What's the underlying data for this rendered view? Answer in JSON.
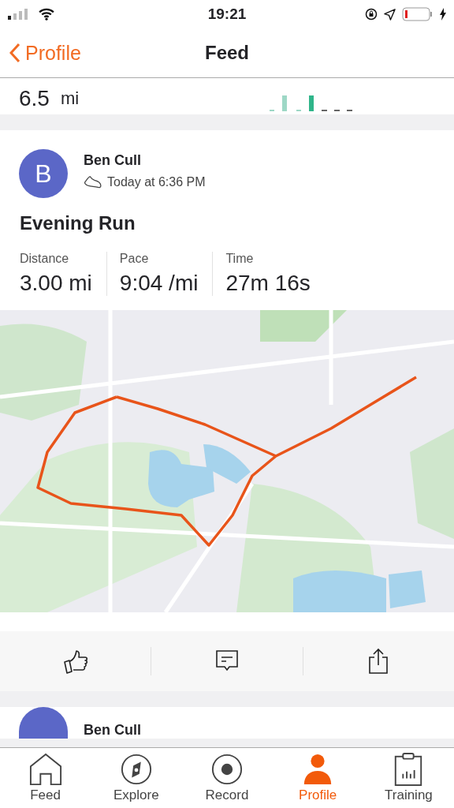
{
  "status_bar": {
    "time": "19:21"
  },
  "nav": {
    "back": "Profile",
    "title": "Feed"
  },
  "prev_card": {
    "value": "6.5",
    "unit": "mi"
  },
  "post": {
    "avatar": "B",
    "athlete": "Ben Cull",
    "time": "Today at 6:36 PM",
    "title": "Evening Run",
    "stats": [
      {
        "label": "Distance",
        "value": "3.00 mi"
      },
      {
        "label": "Pace",
        "value": "9:04 /mi"
      },
      {
        "label": "Time",
        "value": "27m 16s"
      }
    ]
  },
  "next_post": {
    "athlete": "Ben Cull"
  },
  "tabs": [
    {
      "label": "Feed",
      "kind": "home",
      "selected": false
    },
    {
      "label": "Explore",
      "kind": "explore",
      "selected": false
    },
    {
      "label": "Record",
      "kind": "record",
      "selected": false
    },
    {
      "label": "Profile",
      "kind": "profile",
      "selected": true
    },
    {
      "label": "Training",
      "kind": "training",
      "selected": false
    }
  ]
}
